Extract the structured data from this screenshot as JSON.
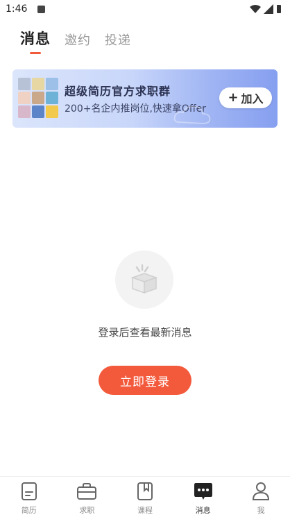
{
  "status": {
    "time": "1:46"
  },
  "tabs": [
    {
      "label": "消息",
      "active": true
    },
    {
      "label": "邀约",
      "active": false
    },
    {
      "label": "投递",
      "active": false
    }
  ],
  "banner": {
    "title": "超级简历官方求职群",
    "subtitle": "200+名企内推岗位,快速拿Offer",
    "join_label": "加入",
    "avatar_colors": [
      "#b7c2d6",
      "#e6d7a3",
      "#9cc0e8",
      "#f0d2c4",
      "#c9a98a",
      "#6fb2d8",
      "#d7b7c9",
      "#5c84c8",
      "#f2c94c"
    ]
  },
  "empty": {
    "message": "登录后查看最新消息",
    "login_label": "立即登录"
  },
  "nav": [
    {
      "label": "简历",
      "icon": "resume-icon",
      "active": false
    },
    {
      "label": "求职",
      "icon": "briefcase-icon",
      "active": false
    },
    {
      "label": "课程",
      "icon": "bookmark-book-icon",
      "active": false
    },
    {
      "label": "消息",
      "icon": "chat-bubble-icon",
      "active": true
    },
    {
      "label": "我",
      "icon": "person-icon",
      "active": false
    }
  ],
  "colors": {
    "accent": "#f3593b",
    "active_nav": "#222222"
  }
}
